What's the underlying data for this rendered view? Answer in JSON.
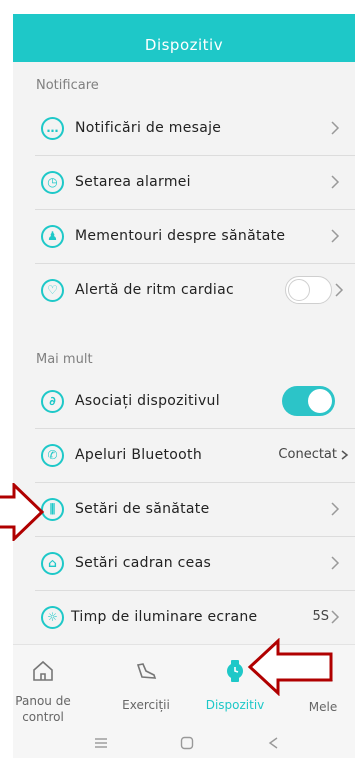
{
  "header": {
    "title": "Dispozitiv"
  },
  "sections": {
    "notifications": "Notificare",
    "more": "Mai mult"
  },
  "rows": {
    "messages": "Notificări de mesaje",
    "alarm": "Setarea alarmei",
    "health_reminders": "Mementouri despre sănătate",
    "heart_alert": "Alertă de ritm cardiac",
    "pair": "Asociați dispozitivul",
    "bluetooth_calls": "Apeluri Bluetooth",
    "bluetooth_status": "Conectat",
    "health_settings": "Setări de sănătate",
    "watch_face": "Setări cadran ceas",
    "screen_time": "Timp de iluminare ecrane",
    "screen_time_value": "5S"
  },
  "toggles": {
    "heart_alert_on": false,
    "pair_on": true
  },
  "nav": {
    "dashboard": "Panou de control",
    "exercises": "Exerciții",
    "device": "Dispozitiv",
    "mine": "Mele"
  },
  "colors": {
    "accent": "#1ec8c8",
    "annotation_arrow": "#b00000"
  },
  "icons": [
    "chat-icon",
    "alarm-icon",
    "reminder-icon",
    "heart-icon",
    "link-icon",
    "phone-icon",
    "sliders-icon",
    "shirt-icon",
    "brightness-icon",
    "home-icon",
    "shoe-icon",
    "watch-icon",
    "user-icon"
  ]
}
